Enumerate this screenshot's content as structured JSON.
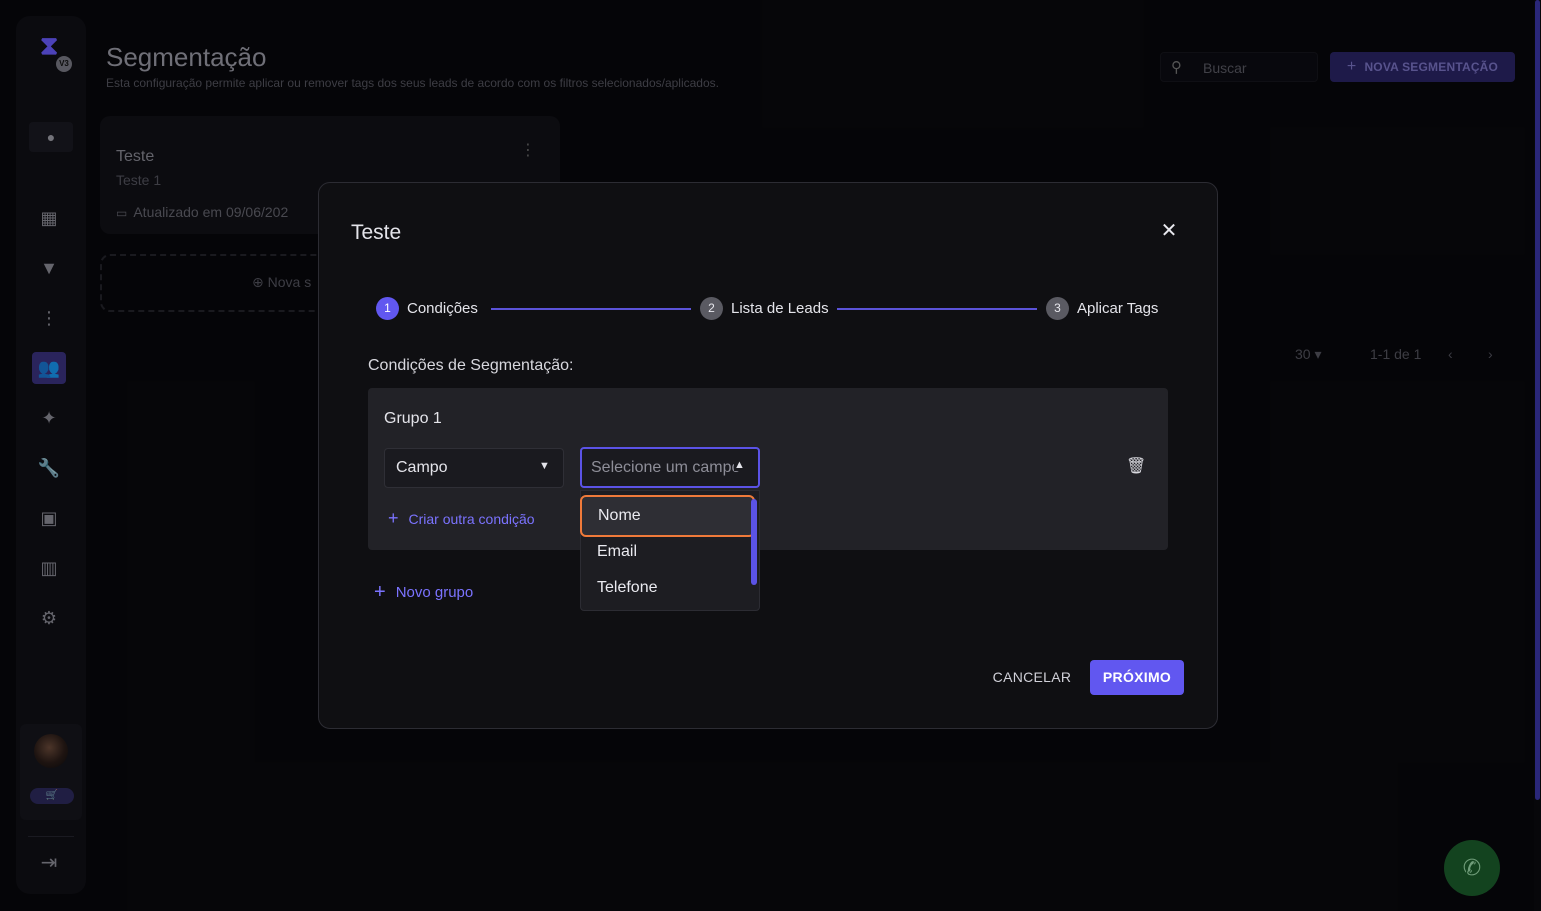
{
  "sidebar": {
    "logo_icon": "hourglass-icon",
    "logo_badge": "V3",
    "items": [
      {
        "name": "dashboard-icon",
        "glyph": "▦",
        "active": false
      },
      {
        "name": "funnel-icon",
        "glyph": "▼",
        "active": false
      },
      {
        "name": "flow-icon",
        "glyph": "⋮",
        "active": false
      },
      {
        "name": "users-group-icon",
        "glyph": "👥",
        "active": true
      },
      {
        "name": "puzzle-icon",
        "glyph": "✦",
        "active": false
      },
      {
        "name": "wrench-icon",
        "glyph": "🔧",
        "active": false
      },
      {
        "name": "apps-icon",
        "glyph": "▣",
        "active": false
      },
      {
        "name": "bar-chart-icon",
        "glyph": "▥",
        "active": false
      },
      {
        "name": "gear-icon",
        "glyph": "⚙",
        "active": false
      }
    ]
  },
  "header": {
    "title": "Segmentação",
    "subtitle": "Esta configuração permite aplicar ou remover tags dos seus leads de acordo com os filtros selecionados/aplicados.",
    "search_placeholder": "Buscar",
    "new_button_label": "NOVA SEGMENTAÇÃO"
  },
  "card": {
    "title": "Teste",
    "subtitle": "Teste 1",
    "updated": "Atualizado em 09/06/202"
  },
  "new_card_label": "Nova s",
  "pagination": {
    "per_page": "30",
    "range": "1-1 de 1"
  },
  "modal": {
    "title": "Teste",
    "steps": [
      {
        "number": "1",
        "label": "Condições"
      },
      {
        "number": "2",
        "label": "Lista de Leads"
      },
      {
        "number": "3",
        "label": "Aplicar Tags"
      }
    ],
    "conditions_title": "Condições de Segmentação:",
    "group_title": "Grupo 1",
    "field_type_value": "Campo",
    "field_placeholder": "Selecione um campo",
    "add_condition_label": "Criar outra condição",
    "new_group_label": "Novo grupo",
    "cancel_label": "CANCELAR",
    "next_label": "PRÓXIMO"
  },
  "dropdown": {
    "options": [
      "Nome",
      "Email",
      "Telefone"
    ]
  },
  "colors": {
    "accent": "#6157f0",
    "highlight": "#f07a3a"
  }
}
